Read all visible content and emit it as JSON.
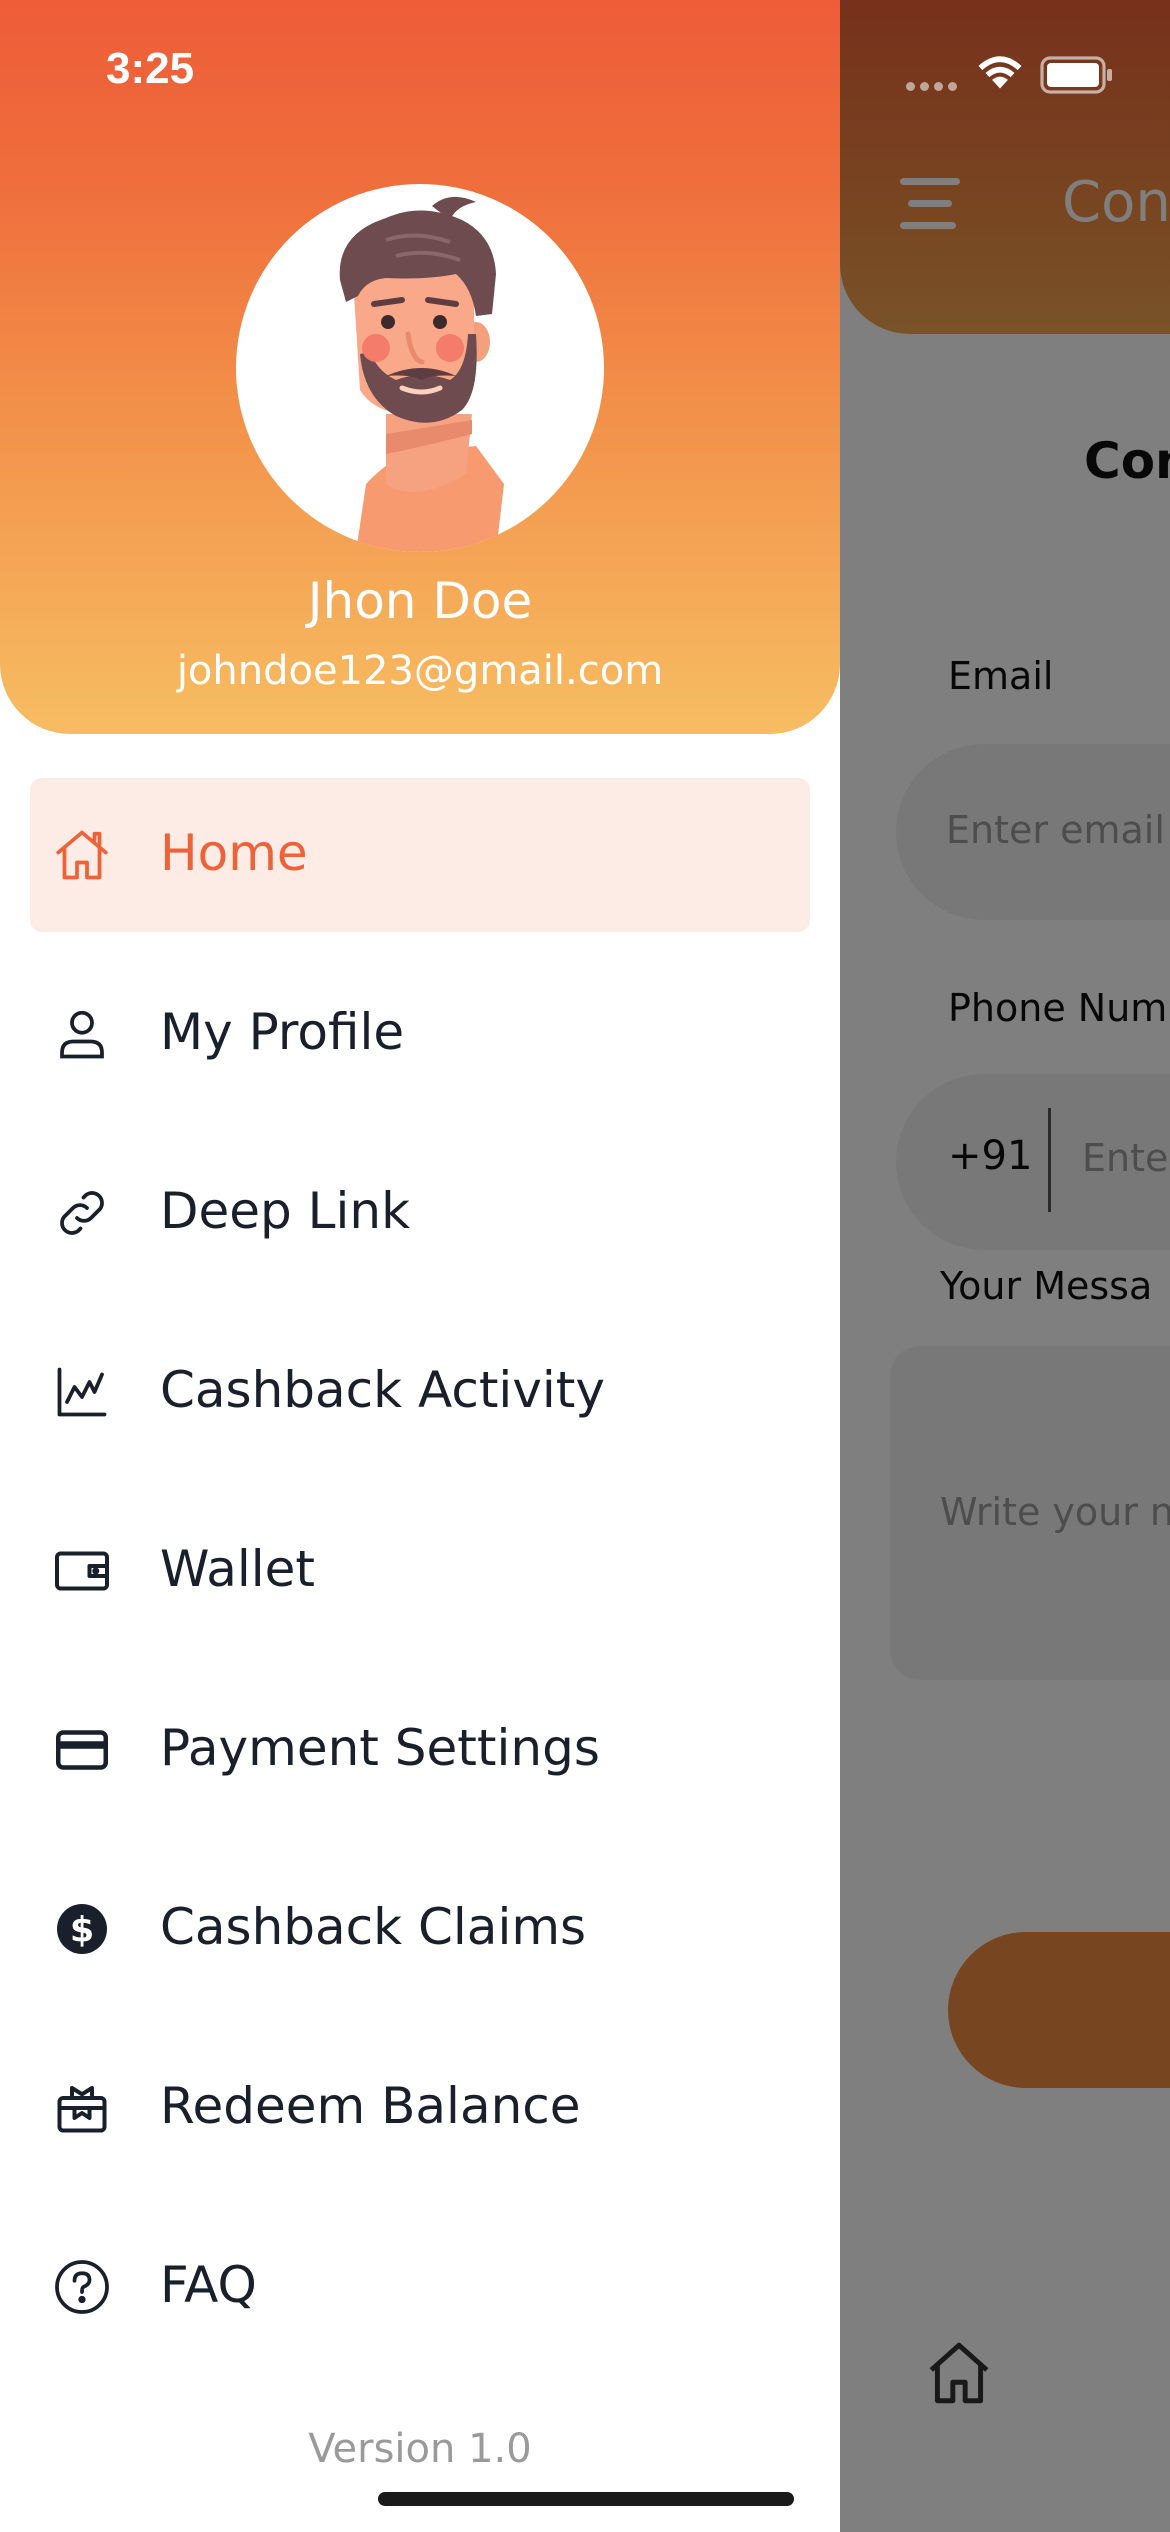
{
  "status_bar": {
    "time": "3:25"
  },
  "background_screen": {
    "app_bar_title": "Con",
    "section_title": "Con",
    "email_label": "Email",
    "email_placeholder": "Enter email",
    "phone_label": "Phone Num",
    "country_code": "+91",
    "phone_placeholder": "Ente",
    "message_label": "Your Messa",
    "message_placeholder": "Write your n"
  },
  "drawer": {
    "user": {
      "name": "Jhon Doe",
      "email": "johndoe123@gmail.com"
    },
    "menu": [
      {
        "label": "Home",
        "icon": "home-icon",
        "active": true
      },
      {
        "label": "My Profile",
        "icon": "user-icon",
        "active": false
      },
      {
        "label": "Deep Link",
        "icon": "link-icon",
        "active": false
      },
      {
        "label": "Cashback Activity",
        "icon": "chart-icon",
        "active": false
      },
      {
        "label": "Wallet",
        "icon": "wallet-icon",
        "active": false
      },
      {
        "label": "Payment Settings",
        "icon": "credit-card-icon",
        "active": false
      },
      {
        "label": "Cashback Claims",
        "icon": "dollar-coin-icon",
        "active": false
      },
      {
        "label": "Redeem Balance",
        "icon": "gift-icon",
        "active": false
      },
      {
        "label": "FAQ",
        "icon": "question-icon",
        "active": false
      }
    ],
    "version": "Version 1.0"
  },
  "colors": {
    "accent": "#ee6238",
    "active_bg": "#fdebe6",
    "text": "#1a1f2c"
  }
}
